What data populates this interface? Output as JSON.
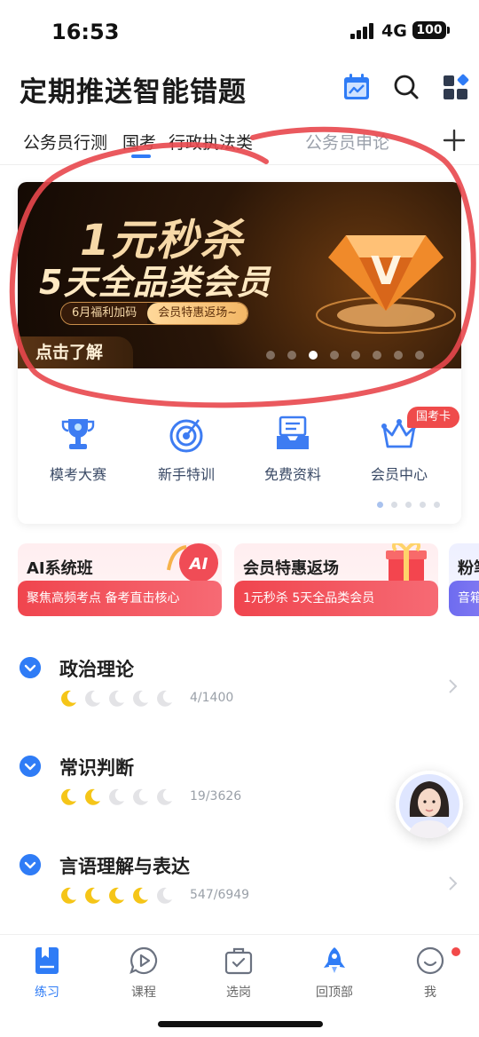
{
  "status_bar": {
    "time": "16:53",
    "network": "4G",
    "battery": "100"
  },
  "header": {
    "title": "定期推送智能错题",
    "icons": [
      "calendar-chart-icon",
      "search-icon",
      "grid-apps-icon"
    ]
  },
  "tabs": [
    {
      "label": "公务员行测",
      "active": false
    },
    {
      "label": "国考",
      "active": true
    },
    {
      "label": "行政执法类",
      "active": false
    },
    {
      "label": "公务员申论",
      "active": false
    }
  ],
  "banner": {
    "headline": "1元秒杀",
    "subheadline": "5天全品类会员",
    "pill_left": "6月福利加码",
    "pill_right": "会员特惠返场~",
    "cta": "点击了解",
    "logo_letter": "V",
    "slide_count": 8,
    "active_slide": 3
  },
  "quick_entries": [
    {
      "label": "模考大赛",
      "icon": "trophy-icon"
    },
    {
      "label": "新手特训",
      "icon": "target-icon"
    },
    {
      "label": "免费资料",
      "icon": "document-tray-icon"
    },
    {
      "label": "会员中心",
      "icon": "crown-icon"
    }
  ],
  "quick_badge": "国考卡",
  "quick_pages": {
    "count": 5,
    "active": 1
  },
  "promos": [
    {
      "title": "AI系统班",
      "subtitle": "聚焦高频考点 备考直击核心",
      "badge": "AI"
    },
    {
      "title": "会员特惠返场",
      "subtitle": "1元秒杀 5天全品类会员"
    },
    {
      "title": "粉笔",
      "subtitle": "音箱"
    }
  ],
  "subjects": [
    {
      "name": "政治理论",
      "progress": "4/1400",
      "moons_filled": 1,
      "moons_total": 5
    },
    {
      "name": "常识判断",
      "progress": "19/3626",
      "moons_filled": 2,
      "moons_total": 5
    },
    {
      "name": "言语理解与表达",
      "progress": "547/6949",
      "moons_filled": 4,
      "moons_total": 5
    }
  ],
  "bottom_nav": [
    {
      "label": "练习",
      "icon": "bookmark-book-icon",
      "active": true
    },
    {
      "label": "课程",
      "icon": "play-bubble-icon",
      "active": false
    },
    {
      "label": "选岗",
      "icon": "briefcase-check-icon",
      "active": false
    },
    {
      "label": "回顶部",
      "icon": "rocket-icon",
      "active": false
    },
    {
      "label": "我",
      "icon": "smile-face-icon",
      "active": false,
      "has_dot": true
    }
  ],
  "colors": {
    "accent": "#2f7cf6",
    "badge_red": "#ef4b4b",
    "annotation": "#e8474c",
    "moon_filled": "#f5c518",
    "moon_empty": "#e3e3e6"
  }
}
